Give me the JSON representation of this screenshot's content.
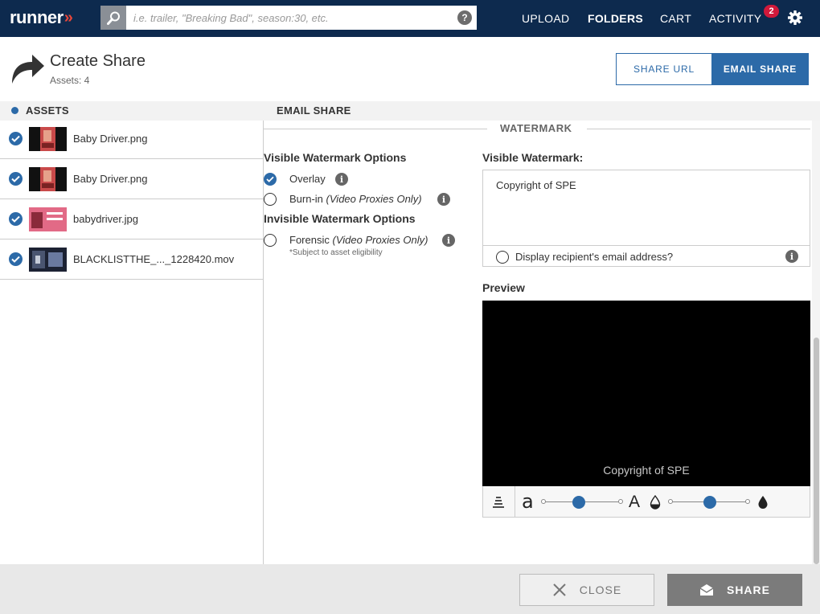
{
  "topbar": {
    "logo_text": "runner",
    "logo_mark": "»",
    "search_placeholder": "i.e. trailer, \"Breaking Bad\", season:30, etc.",
    "help_label": "?",
    "nav": {
      "upload": "UPLOAD",
      "folders": "FOLDERS",
      "cart": "CART",
      "activity": "ACTIVITY",
      "activity_badge": "2"
    },
    "colors": {
      "bar": "#0d2a4e",
      "accent": "#e8473a",
      "badge": "#d0193b"
    }
  },
  "header": {
    "title": "Create Share",
    "subtitle": "Assets: 4",
    "tabs": {
      "share_url": "SHARE URL",
      "email_share": "EMAIL SHARE"
    },
    "active_tab": "email_share"
  },
  "sections": {
    "assets": "ASSETS",
    "email_share": "EMAIL SHARE"
  },
  "assets": [
    {
      "name": "Baby Driver.png",
      "checked": true,
      "thumb": "poster"
    },
    {
      "name": "Baby Driver.png",
      "checked": true,
      "thumb": "poster"
    },
    {
      "name": "babydriver.jpg",
      "checked": true,
      "thumb": "pink-poster"
    },
    {
      "name": "BLACKLISTTHE_..._1228420.mov",
      "checked": true,
      "thumb": "video-still"
    }
  ],
  "watermark": {
    "section_label": "WATERMARK",
    "visible_heading": "Visible Watermark Options",
    "overlay_label": "Overlay",
    "burnin_label": "Burn-in",
    "burnin_note": "(Video Proxies Only)",
    "invisible_heading": "Invisible Watermark Options",
    "forensic_label": "Forensic",
    "forensic_note": "(Video Proxies Only)",
    "eligibility_note": "*Subject to asset eligibility",
    "selected": "overlay",
    "visible_title": "Visible Watermark:",
    "visible_text": "Copyright of SPE",
    "email_option_label": "Display recipient's email address?",
    "preview_title": "Preview",
    "preview_text": "Copyright of SPE",
    "size_slider": 0.5,
    "opacity_slider": 0.5
  },
  "footer": {
    "close_label": "CLOSE",
    "share_label": "SHARE"
  },
  "accent_color": "#2c6aa8"
}
